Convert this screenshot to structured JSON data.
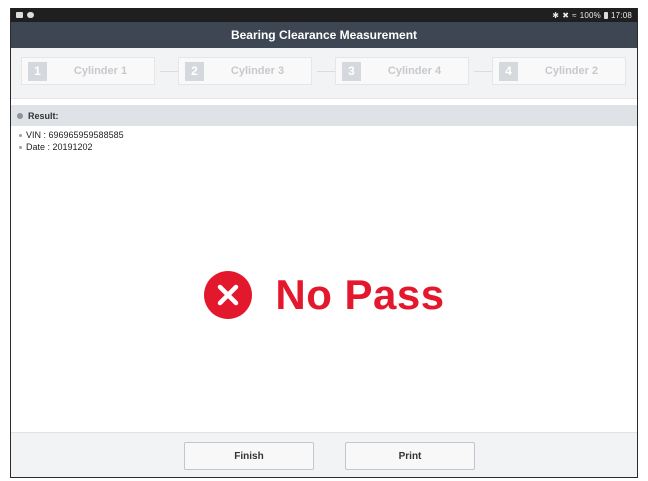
{
  "status_bar": {
    "left_icons": [
      "gallery-icon",
      "android-icon"
    ],
    "bluetooth_icon": "bluetooth-icon",
    "mute_icon": "mute-icon",
    "wifi_icon": "wifi-icon",
    "battery_text": "100%",
    "battery_icon": "battery-icon",
    "time": "17:08"
  },
  "header": {
    "title": "Bearing Clearance Measurement"
  },
  "steps": [
    {
      "number": "1",
      "label": "Cylinder 1"
    },
    {
      "number": "2",
      "label": "Cylinder 3"
    },
    {
      "number": "3",
      "label": "Cylinder 4"
    },
    {
      "number": "4",
      "label": "Cylinder 2"
    }
  ],
  "result": {
    "heading": "Result:",
    "vin": "VIN : 696965959588585",
    "date": "Date : 20191202",
    "verdict": "No Pass",
    "verdict_icon": "fail-x-circle-icon",
    "verdict_color": "#e3182d"
  },
  "footer": {
    "finish_label": "Finish",
    "print_label": "Print"
  }
}
